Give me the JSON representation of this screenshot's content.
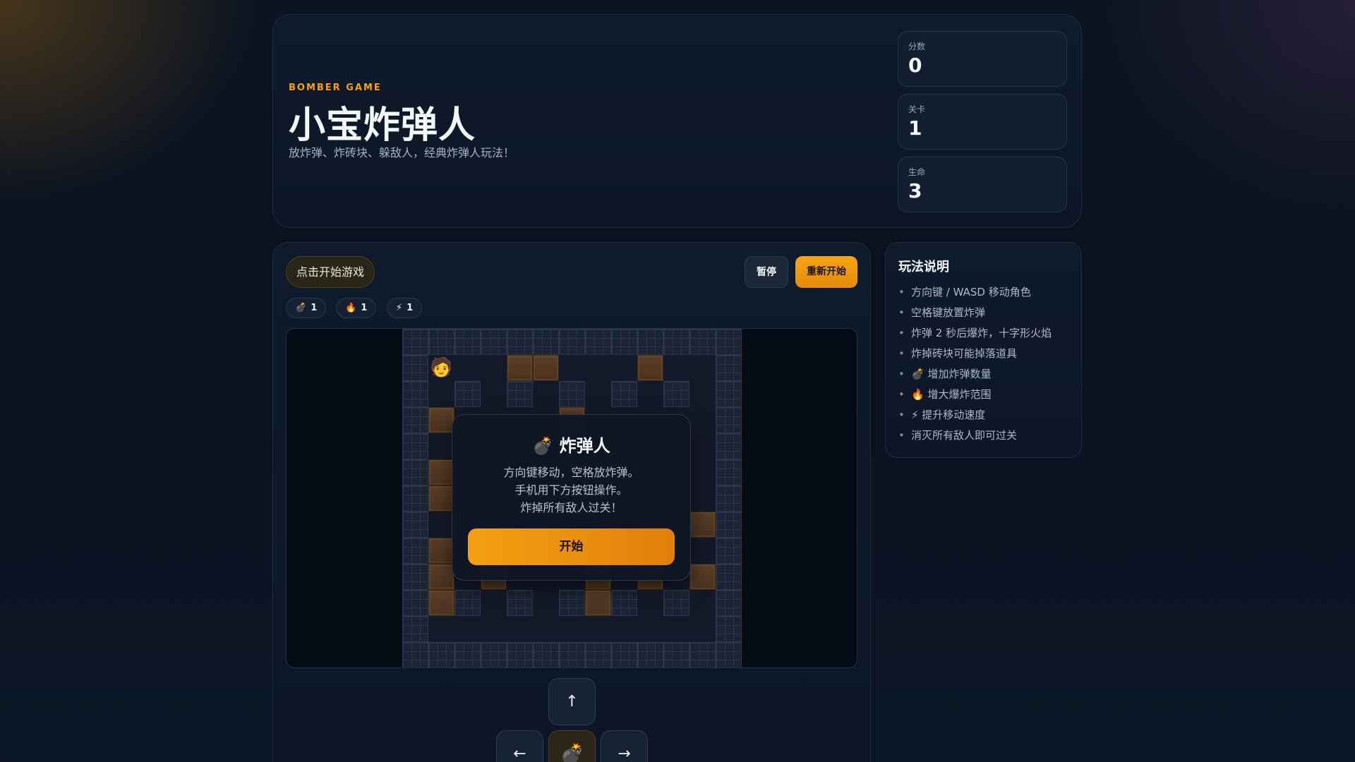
{
  "header": {
    "brand": "BOMBER GAME",
    "title": "小宝炸弹人",
    "subtitle": "放炸弹、炸砖块、躲敌人，经典炸弹人玩法！"
  },
  "stats": [
    {
      "label": "分数",
      "value": "0"
    },
    {
      "label": "关卡",
      "value": "1"
    },
    {
      "label": "生命",
      "value": "3"
    }
  ],
  "toolbar": {
    "status": "点击开始游戏",
    "pause_label": "暂停",
    "restart_label": "重新开始"
  },
  "powerups": [
    {
      "icon": "💣",
      "name": "bomb-count",
      "value": "1"
    },
    {
      "icon": "🔥",
      "name": "fire-range",
      "value": "1"
    },
    {
      "icon": "⚡",
      "name": "speed",
      "value": "1"
    }
  ],
  "board": {
    "player_icon": "🧑",
    "grid_size": 13
  },
  "overlay": {
    "title": "💣 炸弹人",
    "lines": [
      "方向键移动，空格放炸弹。",
      "手机用下方按钮操作。",
      "炸掉所有敌人过关！"
    ],
    "start_label": "开始"
  },
  "controls": {
    "up": "↑",
    "left": "←",
    "bomb": "💣",
    "right": "→"
  },
  "rules": {
    "title": "玩法说明",
    "items": [
      "方向键 / WASD 移动角色",
      "空格键放置炸弹",
      "炸弹 2 秒后爆炸，十字形火焰",
      "炸掉砖块可能掉落道具",
      "💣 增加炸弹数量",
      "🔥 增大爆炸范围",
      "⚡ 提升移动速度",
      "消灭所有敌人即可过关"
    ]
  }
}
